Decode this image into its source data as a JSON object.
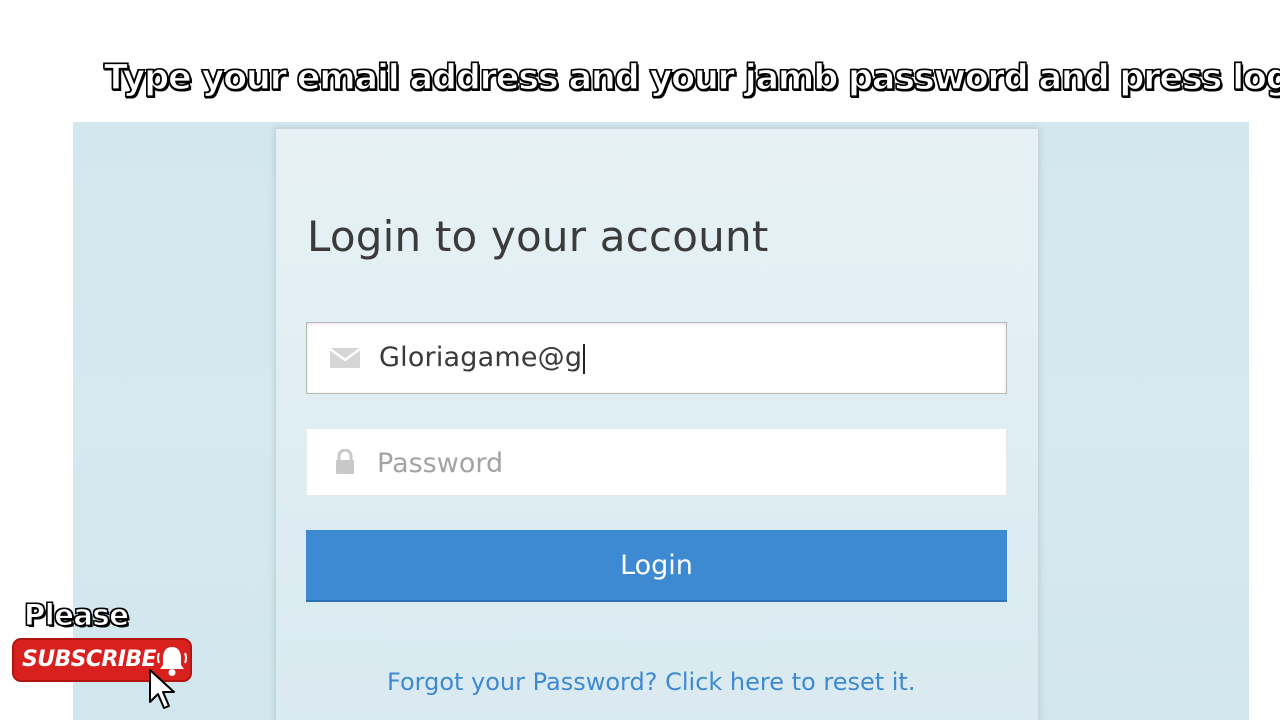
{
  "overlay": {
    "caption": "Type your email address and your jamb password and press login",
    "please_text": "Please",
    "subscribe_label": "SUBSCRIBE"
  },
  "login_form": {
    "title": "Login to your account",
    "email": {
      "value": "Gloriagame@g",
      "icon": "envelope-icon"
    },
    "password": {
      "placeholder": "Password",
      "icon": "lock-icon"
    },
    "login_button": "Login",
    "forgot_link": "Forgot your Password? Click here to reset it."
  },
  "colors": {
    "accent_blue": "#3d8ad2",
    "background": "#d6e9ef",
    "subscribe_red": "#d8211e"
  }
}
